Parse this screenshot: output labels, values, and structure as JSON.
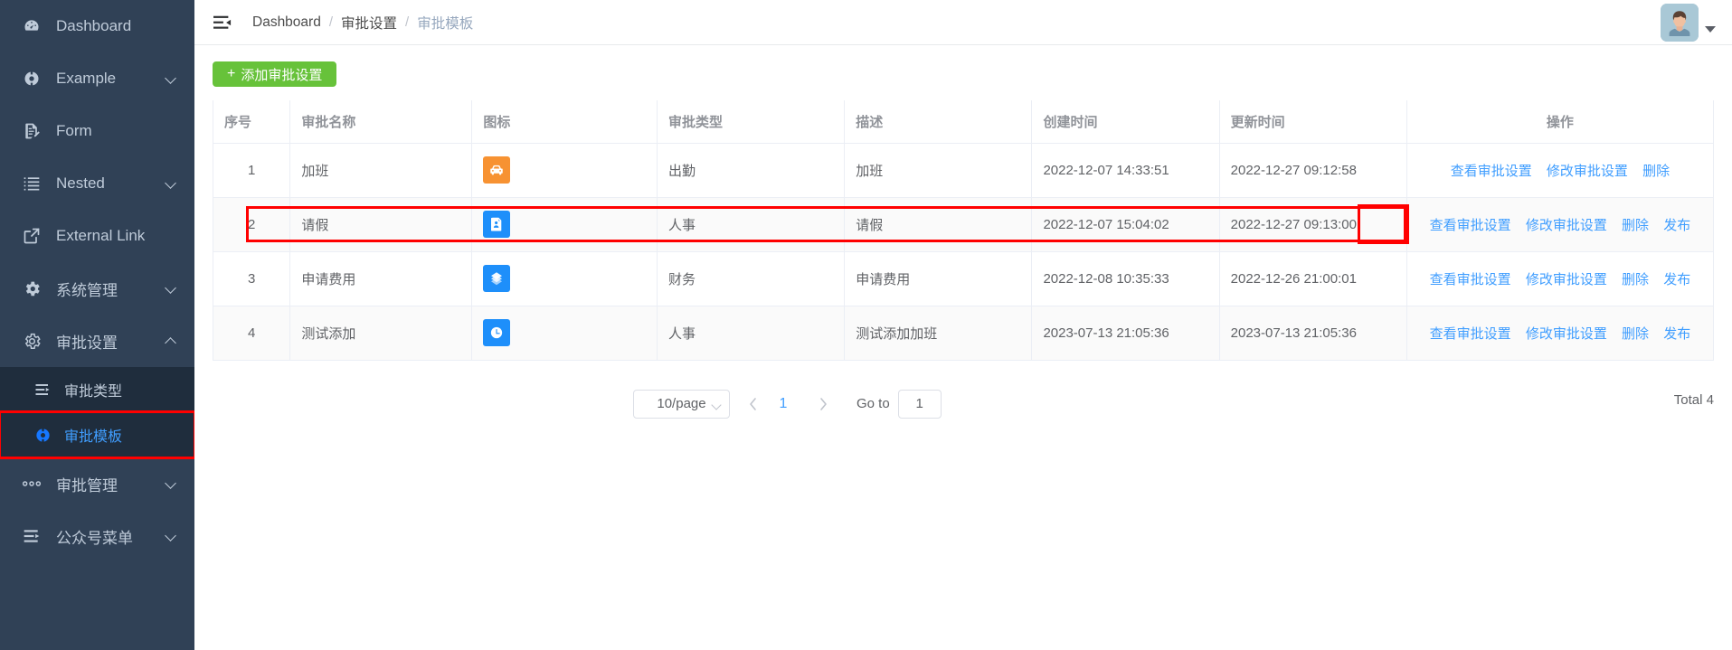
{
  "sidebar": {
    "items": [
      {
        "label": "Dashboard",
        "icon": "dashboard-icon",
        "expandable": false,
        "expanded": false
      },
      {
        "label": "Example",
        "icon": "component-icon",
        "expandable": true,
        "expanded": false
      },
      {
        "label": "Form",
        "icon": "form-icon",
        "expandable": false,
        "expanded": false
      },
      {
        "label": "Nested",
        "icon": "nested-list-icon",
        "expandable": true,
        "expanded": false
      },
      {
        "label": "External Link",
        "icon": "external-link-icon",
        "expandable": false,
        "expanded": false
      },
      {
        "label": "系统管理",
        "icon": "gear-icon",
        "expandable": true,
        "expanded": false
      },
      {
        "label": "审批设置",
        "icon": "settings-gear-icon",
        "expandable": true,
        "expanded": true
      },
      {
        "label": "审批管理",
        "icon": "dots-icon",
        "expandable": true,
        "expanded": false
      },
      {
        "label": "公众号菜单",
        "icon": "menu-list-icon",
        "expandable": true,
        "expanded": false
      }
    ],
    "submenu": [
      {
        "label": "审批类型",
        "icon": "list-icon",
        "active": false,
        "highlighted": false
      },
      {
        "label": "审批模板",
        "icon": "template-icon",
        "active": true,
        "highlighted": true
      }
    ]
  },
  "navbar": {
    "hamburger_icon": "hamburger-icon",
    "breadcrumb": [
      {
        "label": "Dashboard",
        "current": false
      },
      {
        "label": "审批设置",
        "current": false
      },
      {
        "label": "审批模板",
        "current": true
      }
    ],
    "separator": "/",
    "avatar_icon": "user-avatar",
    "caret_icon": "caret-down-icon"
  },
  "toolbar": {
    "add_button_label": "添加审批设置",
    "add_button_plus": "+",
    "add_button_color": "#67c23a"
  },
  "table": {
    "columns": [
      {
        "key": "idx",
        "label": "序号"
      },
      {
        "key": "name",
        "label": "审批名称"
      },
      {
        "key": "icon",
        "label": "图标"
      },
      {
        "key": "type",
        "label": "审批类型"
      },
      {
        "key": "desc",
        "label": "描述"
      },
      {
        "key": "ct",
        "label": "创建时间"
      },
      {
        "key": "ut",
        "label": "更新时间"
      },
      {
        "key": "op",
        "label": "操作"
      }
    ],
    "rows": [
      {
        "idx": "1",
        "name": "加班",
        "type": "出勤",
        "desc": "加班",
        "ct": "2022-12-07 14:33:51",
        "ut": "2022-12-27 09:12:58",
        "icon": {
          "name": "car-icon",
          "color": "#f79232"
        },
        "ops": [
          "查看审批设置",
          "修改审批设置",
          "删除"
        ]
      },
      {
        "idx": "2",
        "name": "请假",
        "type": "人事",
        "desc": "请假",
        "ct": "2022-12-07 15:04:02",
        "ut": "2022-12-27 09:13:00",
        "icon": {
          "name": "id-card-icon",
          "color": "#1e8ffa"
        },
        "ops": [
          "查看审批设置",
          "修改审批设置",
          "删除",
          "发布"
        ]
      },
      {
        "idx": "3",
        "name": "申请费用",
        "type": "财务",
        "desc": "申请费用",
        "ct": "2022-12-08 10:35:33",
        "ut": "2022-12-26 21:00:01",
        "icon": {
          "name": "money-stack-icon",
          "color": "#1e8ffa"
        },
        "ops": [
          "查看审批设置",
          "修改审批设置",
          "删除",
          "发布"
        ]
      },
      {
        "idx": "4",
        "name": "测试添加",
        "type": "人事",
        "desc": "测试添加加班",
        "ct": "2023-07-13 21:05:36",
        "ut": "2023-07-13 21:05:36",
        "icon": {
          "name": "clock-icon",
          "color": "#1e8ffa"
        },
        "ops": [
          "查看审批设置",
          "修改审批设置",
          "删除",
          "发布"
        ]
      }
    ]
  },
  "pagination": {
    "page_size_label": "10/page",
    "prev_icon": "chevron-left-icon",
    "next_icon": "chevron-right-icon",
    "current_page": "1",
    "goto_label": "Go to",
    "goto_value": "1",
    "total_label": "Total 4"
  },
  "annotations": {
    "row_highlight_color": "#ff0000",
    "sidebar_highlight_color": "#ff0000"
  }
}
